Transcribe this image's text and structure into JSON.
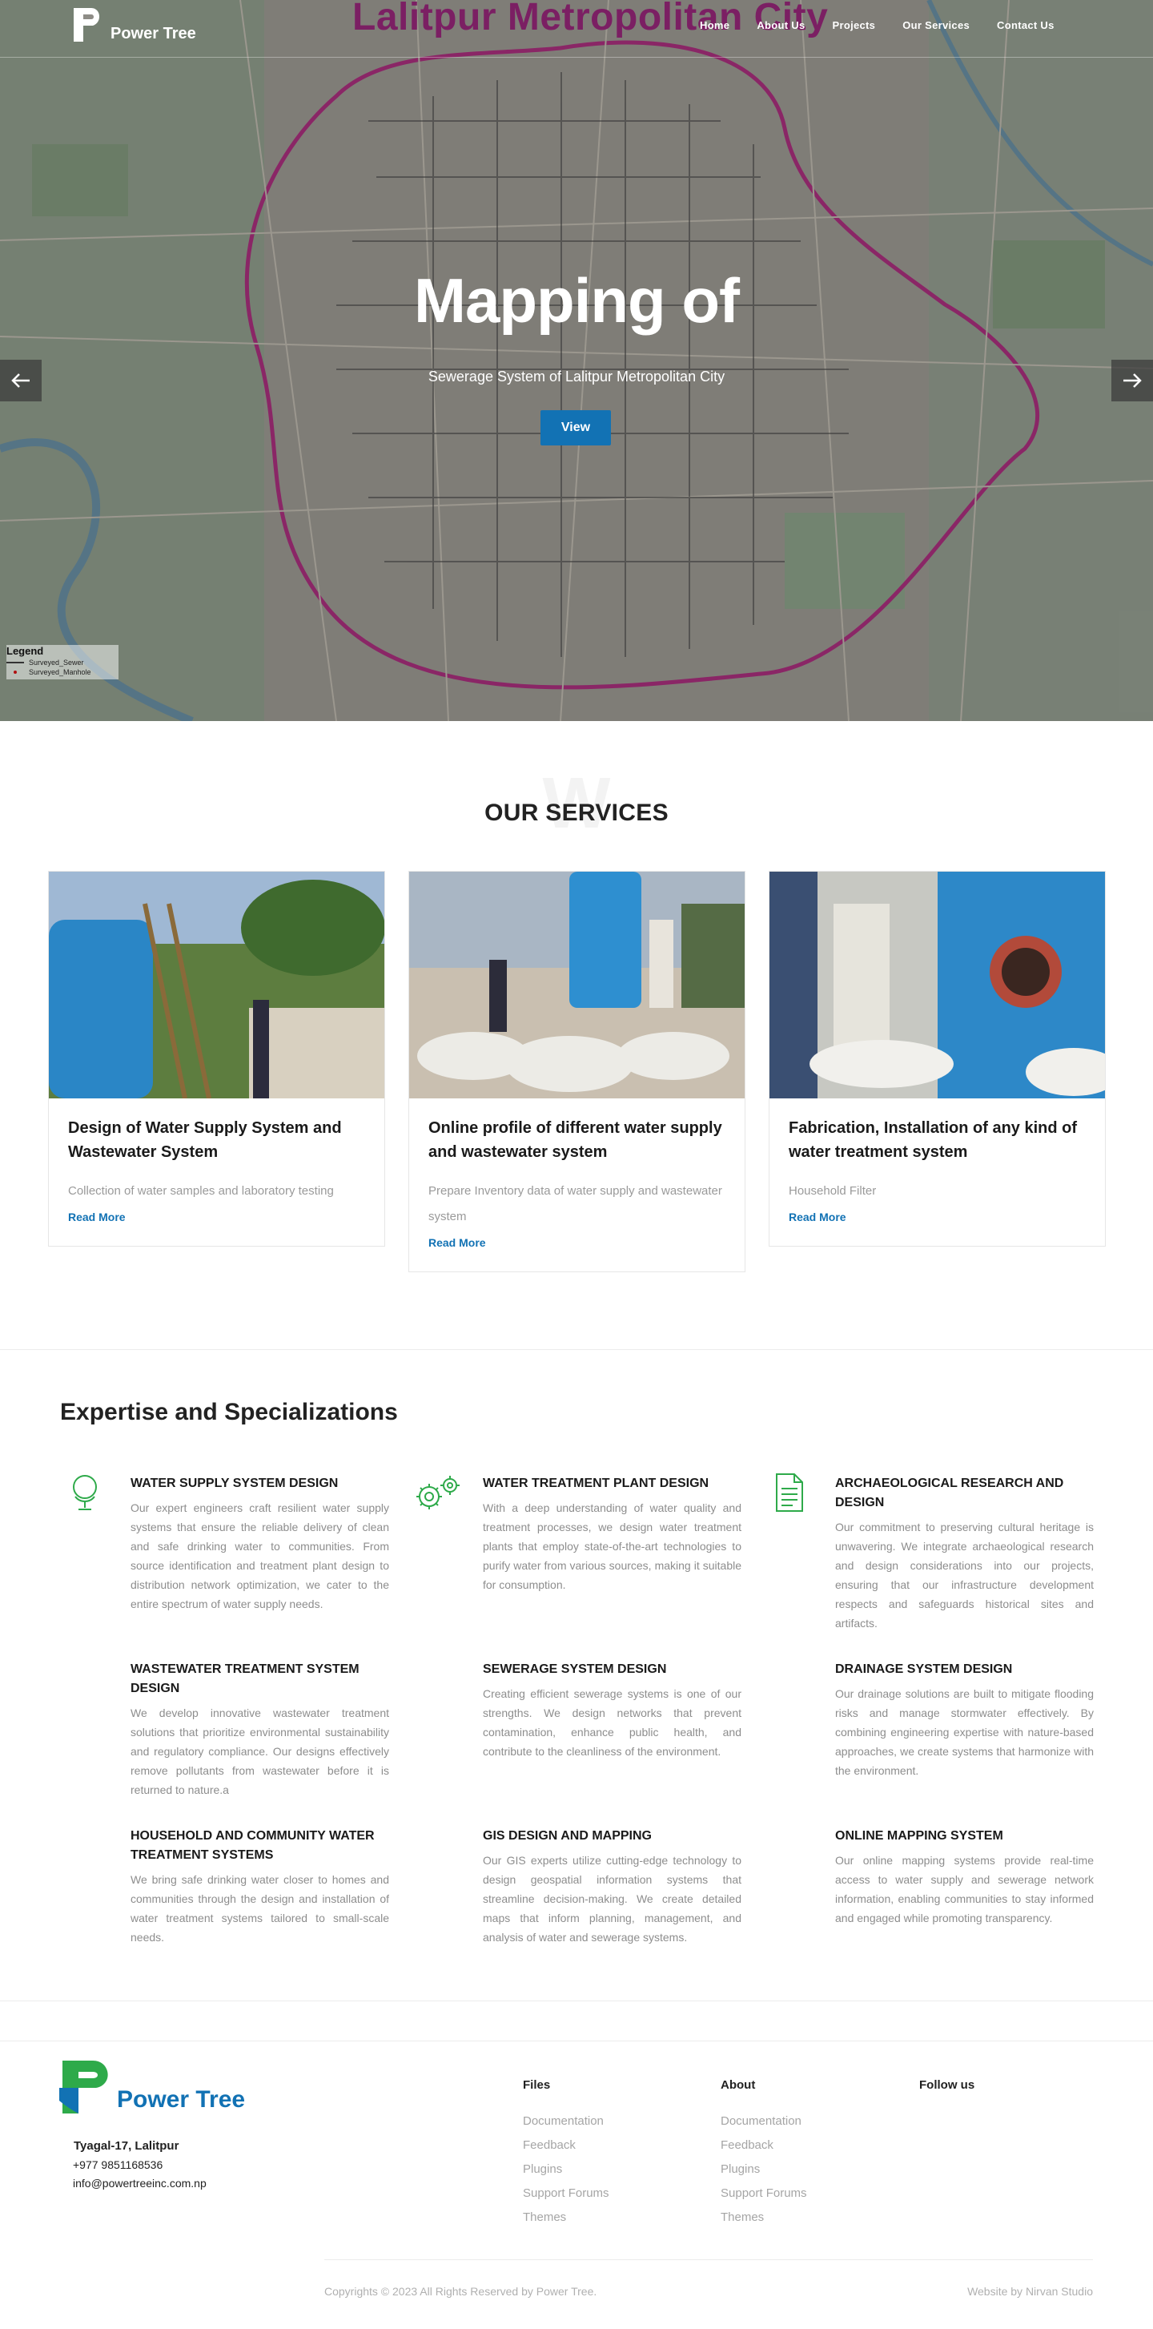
{
  "brand": {
    "name": "Power Tree",
    "primary_color": "#1272b4",
    "green_color": "#2eaa4a"
  },
  "nav": {
    "items": [
      "Home",
      "About Us",
      "Projects",
      "Our Services",
      "Contact Us"
    ]
  },
  "hero": {
    "map_title": "Lalitpur Metropolitan City",
    "heading": "Mapping of",
    "subtitle": "Sewerage System of Lalitpur Metropolitan City",
    "button_label": "View",
    "prev_icon": "arrow-left-icon",
    "next_icon": "arrow-right-icon",
    "legend": {
      "title": "Legend",
      "items": [
        "Surveyed_Sewer",
        "Surveyed_Manhole"
      ]
    }
  },
  "services": {
    "title": "OUR SERVICES",
    "watermark": "W",
    "cards": [
      {
        "title": "Design of Water Supply System and Wastewater System",
        "description": "Collection of water samples and laboratory testing",
        "link": "Read More"
      },
      {
        "title": "Online profile of different water supply and wastewater system",
        "description": "Prepare Inventory data of water supply and wastewater system",
        "link": "Read More"
      },
      {
        "title": "Fabrication, Installation of any kind of water treatment system",
        "description": "Household Filter",
        "link": "Read More"
      }
    ]
  },
  "expertise": {
    "title": "Expertise and Specializations",
    "items": [
      {
        "title": "WATER SUPPLY SYSTEM DESIGN",
        "icon": "globe-icon",
        "text": "Our expert engineers craft resilient water supply systems that ensure the reliable delivery of clean and safe drinking water to communities. From source identification and treatment plant design to distribution network optimization, we cater to the entire spectrum of water supply needs."
      },
      {
        "title": "WATER TREATMENT PLANT DESIGN",
        "icon": "gears-icon",
        "text": "With a deep understanding of water quality and treatment processes, we design water treatment plants that employ state-of-the-art technologies to purify water from various sources, making it suitable for consumption."
      },
      {
        "title": "ARCHAEOLOGICAL RESEARCH AND DESIGN",
        "icon": "document-icon",
        "text": "Our commitment to preserving cultural heritage is unwavering. We integrate archaeological research and design considerations into our projects, ensuring that our infrastructure development respects and safeguards historical sites and artifacts."
      },
      {
        "title": "WASTEWATER TREATMENT SYSTEM DESIGN",
        "icon": "",
        "text": "We develop innovative wastewater treatment solutions that prioritize environmental sustainability and regulatory compliance. Our designs effectively remove pollutants from wastewater before it is returned to nature.a"
      },
      {
        "title": "SEWERAGE SYSTEM DESIGN",
        "icon": "",
        "text": "Creating efficient sewerage systems is one of our strengths. We design networks that prevent contamination, enhance public health, and contribute to the cleanliness of the environment."
      },
      {
        "title": "DRAINAGE SYSTEM DESIGN",
        "icon": "",
        "text": "Our drainage solutions are built to mitigate flooding risks and manage stormwater effectively. By combining engineering expertise with nature-based approaches, we create systems that harmonize with the environment."
      },
      {
        "title": "HOUSEHOLD AND COMMUNITY WATER TREATMENT SYSTEMS",
        "icon": "",
        "text": "We bring safe drinking water closer to homes and communities through the design and installation of water treatment systems tailored to small-scale needs."
      },
      {
        "title": "GIS DESIGN AND MAPPING",
        "icon": "",
        "text": "Our GIS experts utilize cutting-edge technology to design geospatial information systems that streamline decision-making. We create detailed maps that inform planning, management, and analysis of water and sewerage systems."
      },
      {
        "title": "ONLINE MAPPING SYSTEM",
        "icon": "",
        "text": "Our online mapping systems provide real-time access to water supply and sewerage network information, enabling communities to stay informed and engaged while promoting transparency."
      }
    ]
  },
  "footer": {
    "logo_text": "Power Tree",
    "address": "Tyagal-17, Lalitpur",
    "phone": "+977 9851168536",
    "email": "info@powertreeinc.com.np",
    "columns": [
      {
        "title": "Files",
        "links": [
          "Documentation",
          "Feedback",
          "Plugins",
          "Support Forums",
          "Themes"
        ]
      },
      {
        "title": "About",
        "links": [
          "Documentation",
          "Feedback",
          "Plugins",
          "Support Forums",
          "Themes"
        ]
      },
      {
        "title": "Follow us",
        "links": []
      }
    ],
    "copyright": "Copyrights © 2023 All Rights Reserved by Power Tree.",
    "credit": "Website by Nirvan Studio"
  }
}
